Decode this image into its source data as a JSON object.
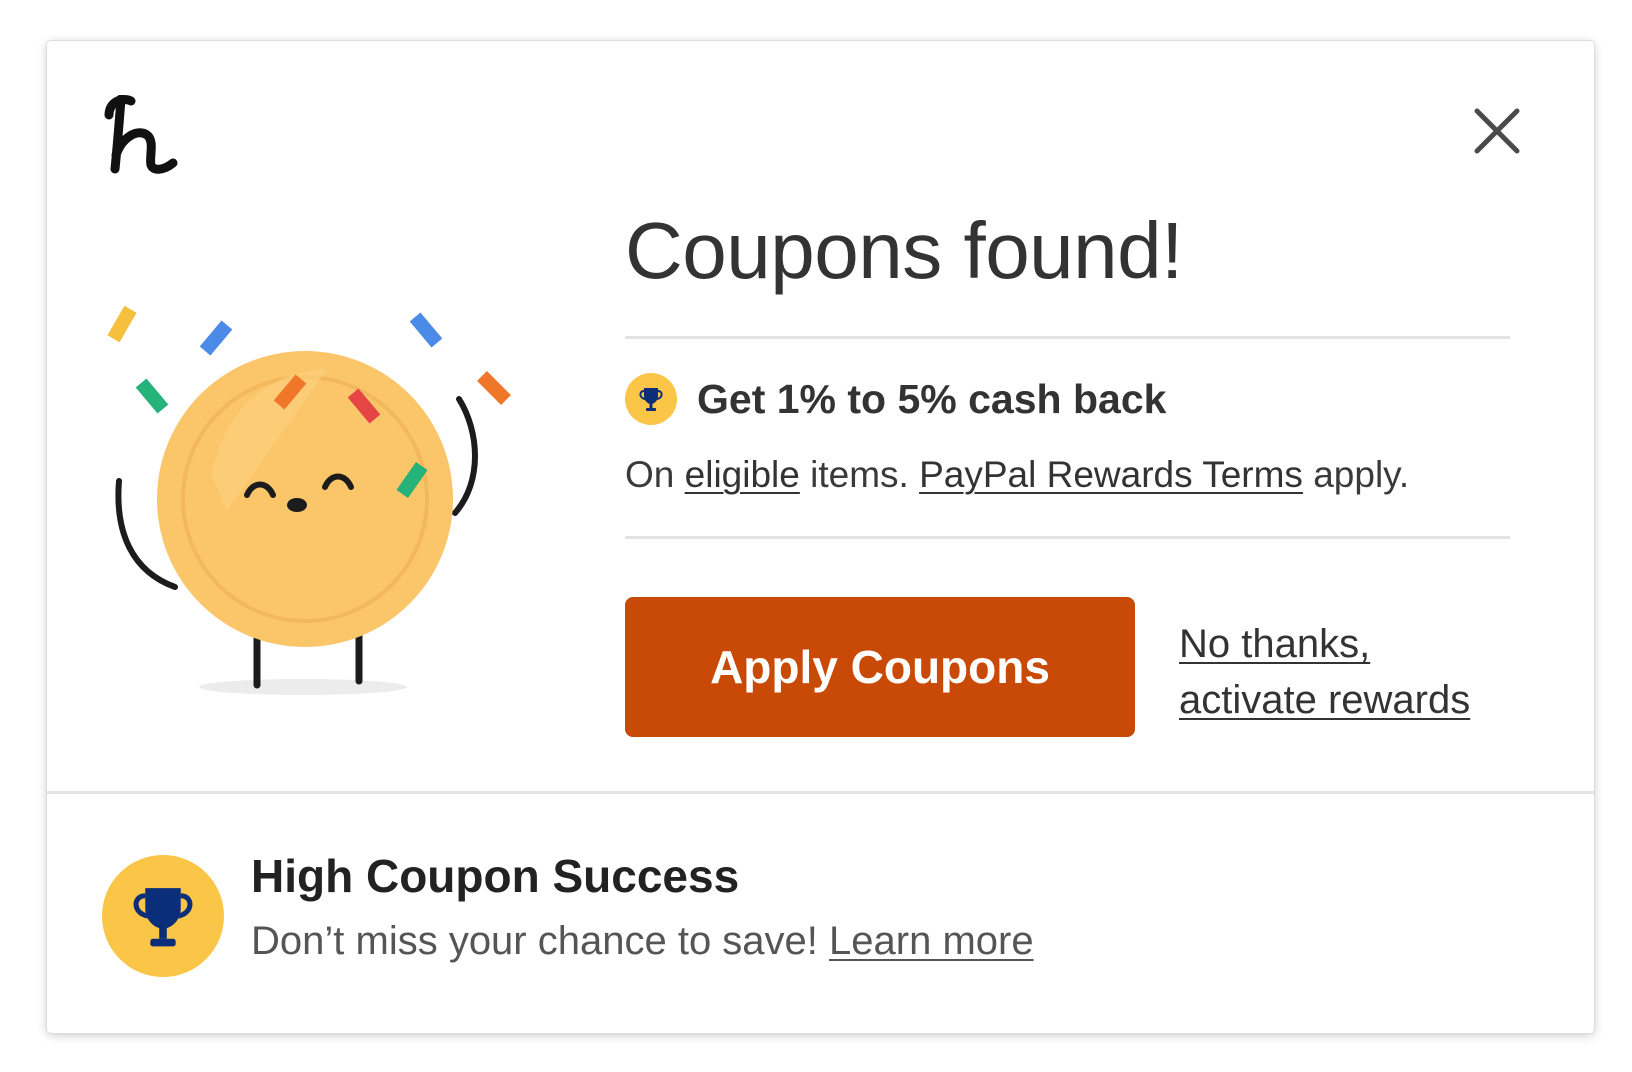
{
  "colors": {
    "accent_button": "#c94a06",
    "badge_yellow": "#fbc548",
    "trophy_blue": "#0b2e7a",
    "coin_yellow": "#fbc56a"
  },
  "header": {
    "logo_icon": "honey-h-logo",
    "close_icon": "close-x-icon"
  },
  "main": {
    "title": "Coupons found!",
    "cashback": {
      "icon": "trophy-icon",
      "text": "Get 1% to 5% cash back"
    },
    "terms": {
      "prefix": "On ",
      "eligible_link": "eligible",
      "middle": " items. ",
      "terms_link": "PayPal Rewards Terms",
      "suffix": " apply."
    },
    "apply_button": "Apply Coupons",
    "no_thanks_line1": "No thanks,",
    "no_thanks_line2": "activate rewards"
  },
  "footer": {
    "icon": "trophy-icon",
    "title": "High Coupon Success",
    "subtitle": "Don’t miss your chance to save! ",
    "learn_more": "Learn more"
  }
}
